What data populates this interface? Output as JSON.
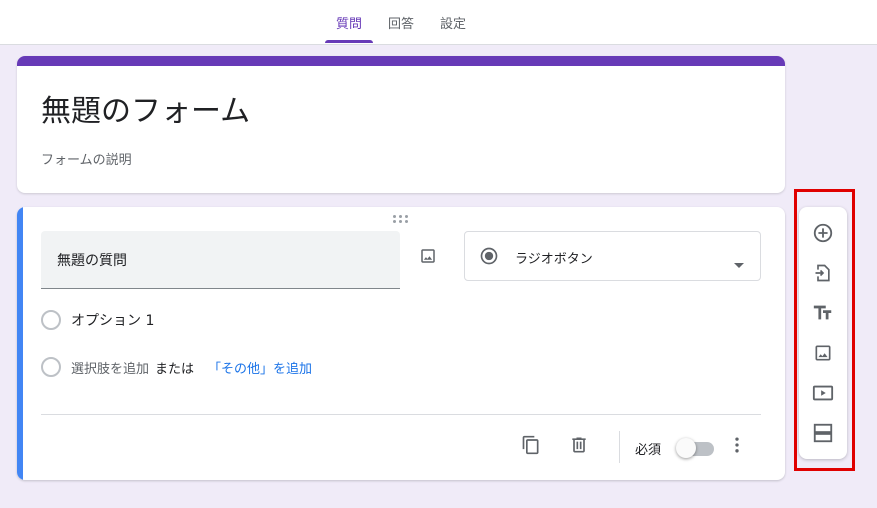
{
  "tabs": [
    {
      "label": "質問",
      "active": true
    },
    {
      "label": "回答",
      "active": false
    },
    {
      "label": "設定",
      "active": false
    }
  ],
  "form": {
    "title": "無題のフォーム",
    "description": "フォームの説明"
  },
  "question": {
    "title": "無題の質問",
    "type_label": "ラジオボタン",
    "options": [
      "オプション 1"
    ],
    "add_option_label": "選択肢を追加",
    "or_label": "または",
    "add_other_label": "「その他」を追加",
    "required_label": "必須",
    "required": false
  },
  "toolbar": {
    "items": [
      "add-question-icon",
      "import-questions-icon",
      "add-title-icon",
      "add-image-icon",
      "add-video-icon",
      "add-section-icon"
    ]
  },
  "colors": {
    "accent": "#673ab7",
    "active_card": "#4285f4",
    "link": "#1a73e8",
    "background": "#f0ebf8",
    "highlight_box": "#e00000"
  }
}
